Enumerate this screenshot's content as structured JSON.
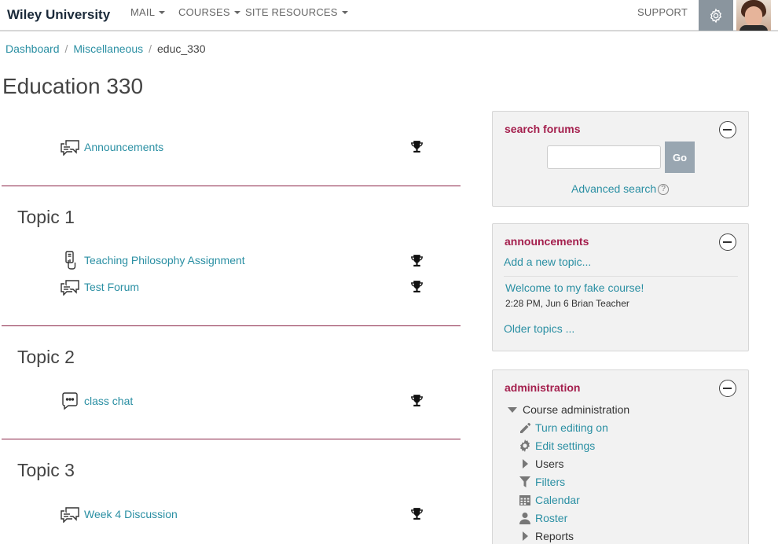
{
  "navbar": {
    "brand": "Wiley University",
    "menu": [
      {
        "label": "MAIL"
      },
      {
        "label": "COURSES"
      },
      {
        "label": "SITE RESOURCES"
      }
    ],
    "support": "SUPPORT"
  },
  "breadcrumb": {
    "items": [
      "Dashboard",
      "Miscellaneous"
    ],
    "current": "educ_330"
  },
  "page_title": "Education 330",
  "sections": {
    "top": {
      "activities": [
        {
          "label": "Announcements",
          "icon": "forum-icon"
        }
      ]
    },
    "topics": [
      {
        "title": "Topic 1",
        "activities": [
          {
            "label": "Teaching Philosophy Assignment",
            "icon": "assignment-icon"
          },
          {
            "label": "Test Forum",
            "icon": "forum-icon"
          }
        ]
      },
      {
        "title": "Topic 2",
        "activities": [
          {
            "label": "class chat",
            "icon": "chat-icon"
          }
        ]
      },
      {
        "title": "Topic 3",
        "activities": [
          {
            "label": "Week 4 Discussion",
            "icon": "forum-icon"
          }
        ]
      }
    ]
  },
  "blocks": {
    "search": {
      "title": "search forums",
      "go_label": "Go",
      "advanced": "Advanced search",
      "help": "?"
    },
    "announcements": {
      "title": "announcements",
      "add_link": "Add a new topic...",
      "post_title": "Welcome to my fake course!",
      "post_meta": "2:28 PM, Jun 6  Brian Teacher",
      "older": "Older topics ..."
    },
    "administration": {
      "title": "administration",
      "course_admin": "Course administration",
      "items": [
        {
          "label": "Turn editing on",
          "icon": "pencil-icon"
        },
        {
          "label": "Edit settings",
          "icon": "gear-icon"
        },
        {
          "label": "Users",
          "icon": "expand-arrow-icon"
        },
        {
          "label": "Filters",
          "icon": "filter-icon"
        },
        {
          "label": "Calendar",
          "icon": "calendar-icon"
        },
        {
          "label": "Roster",
          "icon": "user-icon"
        },
        {
          "label": "Reports",
          "icon": "expand-arrow-icon"
        }
      ]
    }
  },
  "colors": {
    "link": "#2a8fa3",
    "block_title": "#a41f4d",
    "divider": "#8a2346",
    "brand": "#1b2a3a"
  }
}
